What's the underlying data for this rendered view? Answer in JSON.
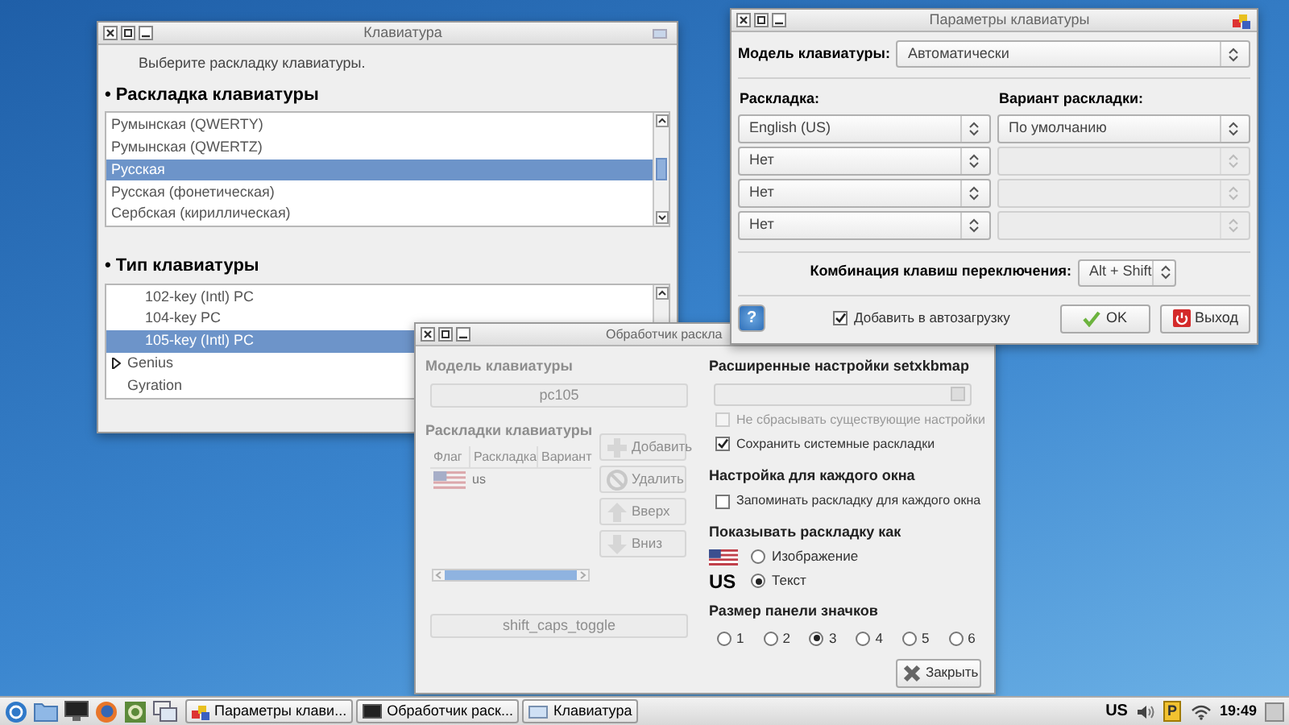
{
  "keyboard_window": {
    "title": "Клавиатура",
    "instruction": "Выберите раскладку клавиатуры.",
    "layout_heading": "• Раскладка клавиатуры",
    "layout_list": [
      {
        "label": "Румынская (QWERTY)",
        "selected": false
      },
      {
        "label": "Румынская (QWERTZ)",
        "selected": false
      },
      {
        "label": "Русская",
        "selected": true
      },
      {
        "label": "Русская (фонетическая)",
        "selected": false
      },
      {
        "label": "Сербская (кириллическая)",
        "selected": false
      }
    ],
    "type_heading": "• Тип клавиатуры",
    "type_list": [
      {
        "children": [
          {
            "label": "102-key (Intl) PC",
            "selected": false
          },
          {
            "label": "104-key PC",
            "selected": false
          },
          {
            "label": "105-key (Intl) PC",
            "selected": true
          }
        ]
      },
      {
        "label": "Genius",
        "selected": false,
        "expanded": false
      },
      {
        "label": "Gyration",
        "selected": false
      }
    ]
  },
  "settings_window": {
    "title": "Параметры клавиатуры",
    "model_label": "Модель клавиатуры:",
    "model_value": "Автоматически",
    "layout_label": "Раскладка:",
    "variant_label": "Вариант раскладки:",
    "rows": [
      {
        "layout": "English (US)",
        "variant": "По умолчанию",
        "variant_disabled": false
      },
      {
        "layout": "Нет",
        "variant_disabled": true
      },
      {
        "layout": "Нет",
        "variant_disabled": true
      },
      {
        "layout": "Нет",
        "variant_disabled": true
      }
    ],
    "switch_label": "Комбинация клавиш переключения:",
    "switch_value": "Alt + Shift",
    "help_button": "?",
    "autostart": {
      "label": "Добавить в автозагрузку",
      "checked": true
    },
    "ok_button": "OK",
    "exit_button": "Выход"
  },
  "handler_window": {
    "title": "Обработчик раскла",
    "left_panel_disabled": true,
    "model_heading": "Модель клавиатуры",
    "model_button": "pc105",
    "layouts_heading": "Раскладки клавиатуры",
    "table_columns": [
      "Флаг",
      "Раскладка",
      "Вариант"
    ],
    "table_rows": [
      {
        "layout": "us"
      }
    ],
    "side_buttons": [
      {
        "kind": "add",
        "label": "Добавить"
      },
      {
        "kind": "remove",
        "label": "Удалить"
      },
      {
        "kind": "up",
        "label": "Вверх"
      },
      {
        "kind": "down",
        "label": "Вниз"
      }
    ],
    "options_button": "shift_caps_toggle",
    "advanced_heading": "Расширенные настройки setxkbmap",
    "options": [
      {
        "label": "Не сбрасывать существующие настройки",
        "checked": false,
        "disabled": true
      },
      {
        "label": "Сохранить системные раскладки",
        "checked": true,
        "disabled": false
      }
    ],
    "per_window_heading": "Настройка для каждого окна",
    "per_window_option": {
      "label": "Запоминать раскладку для каждого окна",
      "checked": false
    },
    "display_heading": "Показывать раскладку как",
    "display_modes": [
      {
        "kind": "flag",
        "label": "Изображение",
        "selected": false
      },
      {
        "kind": "text",
        "sample": "US",
        "label": "Текст",
        "selected": true
      }
    ],
    "size_heading": "Размер панели значков",
    "sizes": [
      {
        "label": "1",
        "selected": false
      },
      {
        "label": "2",
        "selected": false
      },
      {
        "label": "3",
        "selected": true
      },
      {
        "label": "4",
        "selected": false
      },
      {
        "label": "5",
        "selected": false
      },
      {
        "label": "6",
        "selected": false
      }
    ],
    "close_button": "Закрыть"
  },
  "taskbar": {
    "tasks": [
      {
        "kind": "settings",
        "label": "Параметры клави..."
      },
      {
        "kind": "terminal",
        "label": "Обработчик раск..."
      },
      {
        "kind": "window",
        "label": "Клавиатура"
      }
    ],
    "layout_indicator": "US",
    "indicator_letter": "P",
    "clock": "19:49"
  }
}
